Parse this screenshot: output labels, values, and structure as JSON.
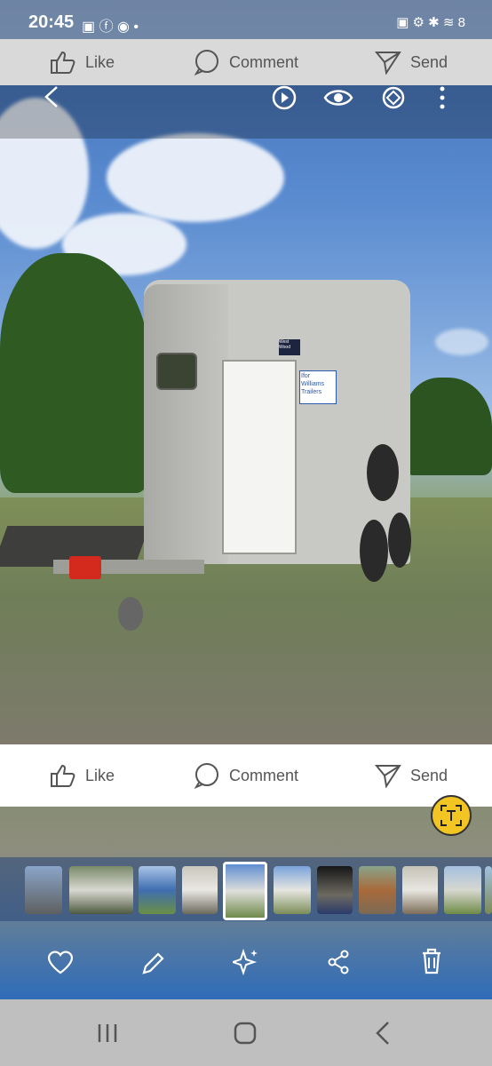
{
  "status_bar": {
    "time": "20:45",
    "right_text": "8"
  },
  "share_bar_top": {
    "like_label": "Like",
    "comment_label": "Comment",
    "send_label": "Send"
  },
  "viewer_header": {
    "icons": [
      "back-icon",
      "play-icon",
      "eye-icon",
      "rotate-icon",
      "more-icon"
    ]
  },
  "photo": {
    "trailer_brand": "Ifor Williams Trailers",
    "sticker_text": "West Wood"
  },
  "share_bar_bottom": {
    "like_label": "Like",
    "comment_label": "Comment",
    "send_label": "Send"
  },
  "thumbnails": {
    "count": 11,
    "selected_index": 4
  },
  "bottom_tools": {
    "icons": [
      "heart-icon",
      "edit-icon",
      "sparkle-icon",
      "share-icon",
      "trash-icon"
    ]
  },
  "navigation": {
    "icons": [
      "recents-icon",
      "home-icon",
      "back-icon"
    ]
  },
  "colors": {
    "accent_yellow": "#f2c522",
    "sky": "#5a8bd0",
    "grass": "#7f8f58"
  }
}
